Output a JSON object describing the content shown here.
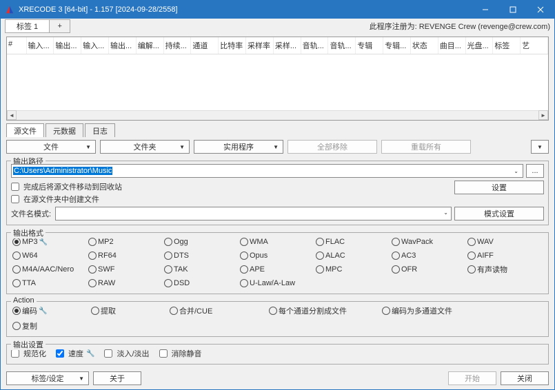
{
  "titlebar": {
    "title": "XRECODE 3 [64-bit] - 1.157 [2024-09-28/2558]"
  },
  "registration": "此程序注册为: REVENGE Crew (revenge@crew.com)",
  "top_tab": {
    "label": "标签 1"
  },
  "grid_columns": [
    "#",
    "输入...",
    "输出...",
    "输入...",
    "输出...",
    "编解...",
    "持续...",
    "通道",
    "比特率",
    "采样率",
    "采样...",
    "音轨...",
    "音轨...",
    "专辑",
    "专辑...",
    "状态",
    "曲目...",
    "光盘...",
    "标签",
    "艺"
  ],
  "mid_tabs": {
    "source": "源文件",
    "metadata": "元数据",
    "log": "日志"
  },
  "toolbar": {
    "file": "文件",
    "folder": "文件夹",
    "utility": "实用程序",
    "remove_all": "全部移除",
    "reset_all": "重载所有"
  },
  "output_path_section": {
    "label": "输出路径",
    "path": "C:\\Users\\Administrator\\Music",
    "browse": "...",
    "settings_btn": "设置",
    "chk_recycle": "完成后将源文件移动到回收站",
    "chk_create_in_source": "在源文件夹中创建文件",
    "pattern_label": "文件名模式:",
    "pattern_settings": "模式设置"
  },
  "output_format_section": {
    "label": "输出格式",
    "formats": [
      {
        "name": "MP3",
        "checked": true,
        "wrench": true
      },
      {
        "name": "MP2"
      },
      {
        "name": "Ogg"
      },
      {
        "name": "WMA"
      },
      {
        "name": "FLAC"
      },
      {
        "name": "WavPack"
      },
      {
        "name": "WAV"
      },
      {
        "name": "W64"
      },
      {
        "name": "RF64"
      },
      {
        "name": "DTS"
      },
      {
        "name": "Opus"
      },
      {
        "name": "ALAC"
      },
      {
        "name": "AC3"
      },
      {
        "name": "AIFF"
      },
      {
        "name": "M4A/AAC/Nero"
      },
      {
        "name": "SWF"
      },
      {
        "name": "TAK"
      },
      {
        "name": "APE"
      },
      {
        "name": "MPC"
      },
      {
        "name": "OFR"
      },
      {
        "name": "有声读物"
      },
      {
        "name": "TTA"
      },
      {
        "name": "RAW"
      },
      {
        "name": "DSD"
      },
      {
        "name": "U-Law/A-Law"
      }
    ]
  },
  "action_section": {
    "label": "Action",
    "actions": [
      {
        "name": "编码",
        "checked": true,
        "wrench": true
      },
      {
        "name": "提取"
      },
      {
        "name": "合并/CUE"
      },
      {
        "name": "每个通道分割成文件"
      },
      {
        "name": "编码为多通道文件"
      },
      {
        "name": "复制"
      }
    ]
  },
  "output_settings_section": {
    "label": "输出设置",
    "normalize": "规范化",
    "speed": "速度",
    "fade": "淡入/淡出",
    "silence": "消除静音"
  },
  "bottom": {
    "tag_settings": "标签/设定",
    "about": "关于",
    "start": "开始",
    "close": "关闭"
  }
}
